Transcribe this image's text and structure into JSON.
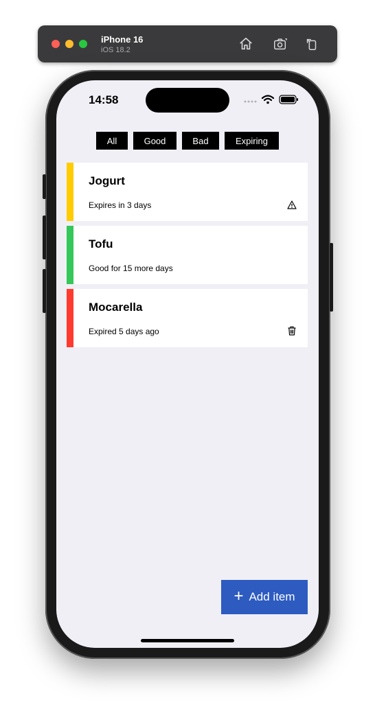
{
  "simulator": {
    "device_name": "iPhone 16",
    "os_version": "iOS 18.2",
    "buttons": [
      {
        "icon": "home-icon"
      },
      {
        "icon": "screenshot-icon"
      },
      {
        "icon": "rotate-icon"
      }
    ]
  },
  "status_bar": {
    "time": "14:58",
    "icons": [
      "signal-dots-icon",
      "wifi-icon",
      "battery-icon"
    ]
  },
  "filters": [
    {
      "label": "All"
    },
    {
      "label": "Good"
    },
    {
      "label": "Bad"
    },
    {
      "label": "Expiring"
    }
  ],
  "items": [
    {
      "name": "Jogurt",
      "status": "Expires in 3 days",
      "color": "#ffcc00",
      "action_icon": "warning-icon"
    },
    {
      "name": "Tofu",
      "status": "Good for 15 more days",
      "color": "#34c759",
      "action_icon": ""
    },
    {
      "name": "Mocarella",
      "status": "Expired 5 days ago",
      "color": "#ff3b30",
      "action_icon": "trash-icon"
    }
  ],
  "add_button": {
    "icon": "plus-icon",
    "label": "Add item"
  },
  "colors": {
    "accent": "#2d5bc0",
    "background": "#f0eff5",
    "filter_bg": "#000000"
  }
}
